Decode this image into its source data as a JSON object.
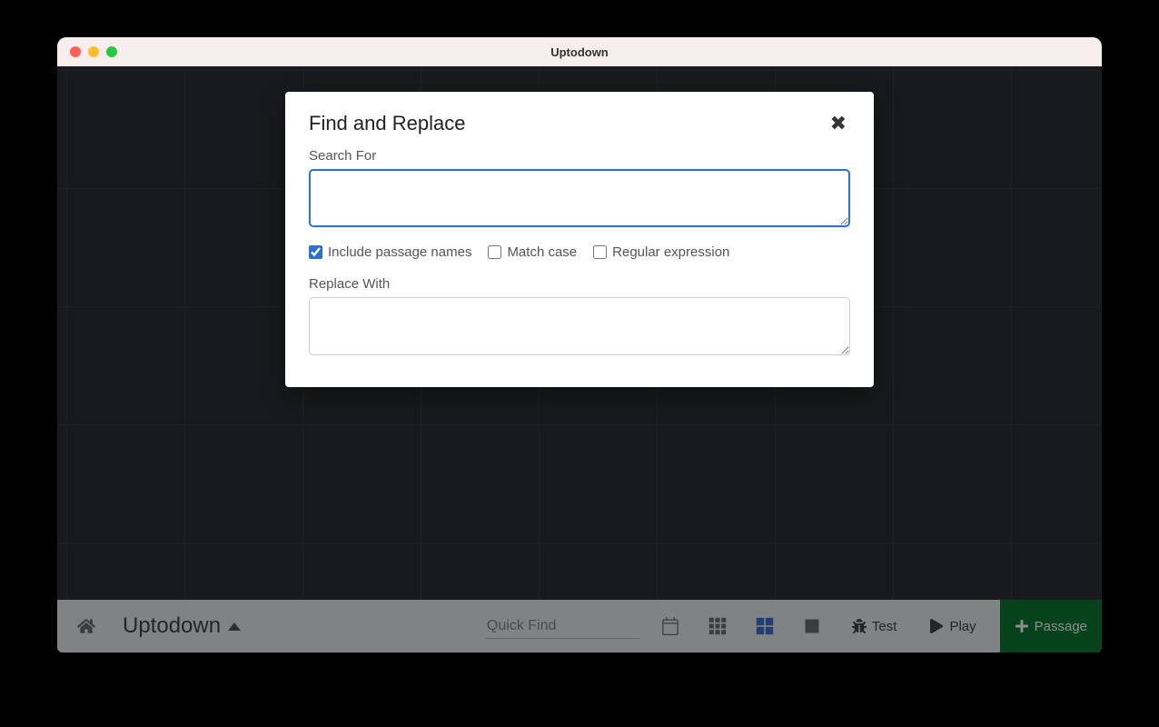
{
  "window": {
    "title": "Uptodown"
  },
  "modal": {
    "title": "Find and Replace",
    "search_label": "Search For",
    "search_value": "",
    "replace_label": "Replace With",
    "replace_value": "",
    "checks": {
      "include_passage_names": {
        "label": "Include passage names",
        "checked": true
      },
      "match_case": {
        "label": "Match case",
        "checked": false
      },
      "regex": {
        "label": "Regular expression",
        "checked": false
      }
    }
  },
  "bottombar": {
    "project_name": "Uptodown",
    "quick_find_placeholder": "Quick Find",
    "test_label": "Test",
    "play_label": "Play",
    "passage_label": "Passage"
  }
}
